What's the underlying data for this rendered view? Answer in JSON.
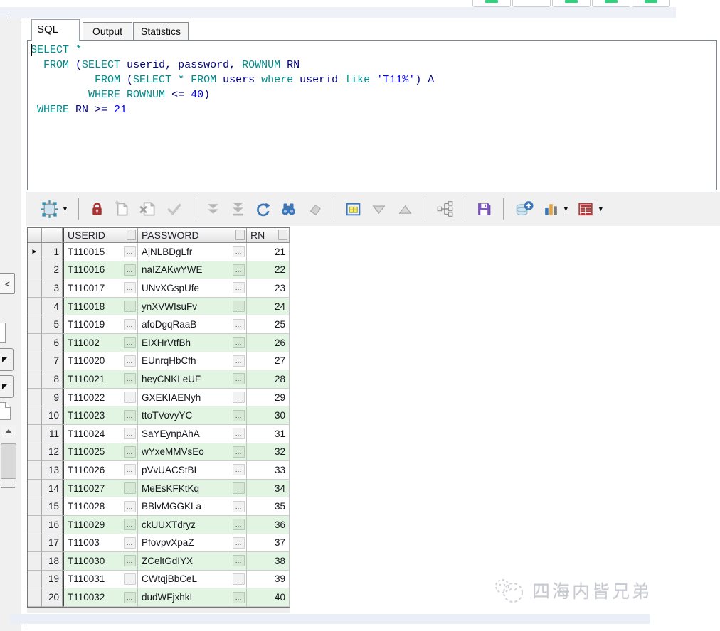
{
  "colors": {
    "keyword": "#008B8B",
    "identifier": "#000080",
    "literal": "#0000FF",
    "row_alt": "#e2f5e2",
    "lock_red": "#A83232",
    "save_purple": "#7E57C2",
    "toolbar_blue": "#3A76B8",
    "chart_orange": "#E3A53F",
    "report_red": "#B23A3A",
    "green_dash": "#35d07f"
  },
  "top_buttons": [
    {
      "glyph": true
    },
    {
      "glyph": false
    },
    {
      "glyph": true
    },
    {
      "glyph": true
    },
    {
      "glyph": true
    }
  ],
  "left_rail": {
    "collapse_label": "<"
  },
  "tabs": {
    "items": [
      {
        "label": "SQL",
        "active": true
      },
      {
        "label": "Output",
        "active": false
      },
      {
        "label": "Statistics",
        "active": false
      }
    ]
  },
  "editor": {
    "lines": [
      [
        {
          "t": "SELECT",
          "c": "kw"
        },
        {
          "t": " ",
          "c": "pl"
        },
        {
          "t": "*",
          "c": "kw"
        }
      ],
      [
        {
          "t": "  ",
          "c": "pl"
        },
        {
          "t": "FROM",
          "c": "kw"
        },
        {
          "t": " (",
          "c": "id"
        },
        {
          "t": "SELECT",
          "c": "kw"
        },
        {
          "t": " userid, password, ",
          "c": "id"
        },
        {
          "t": "ROWNUM",
          "c": "kw"
        },
        {
          "t": " RN",
          "c": "id"
        }
      ],
      [
        {
          "t": "          ",
          "c": "pl"
        },
        {
          "t": "FROM",
          "c": "kw"
        },
        {
          "t": " (",
          "c": "id"
        },
        {
          "t": "SELECT",
          "c": "kw"
        },
        {
          "t": " ",
          "c": "pl"
        },
        {
          "t": "*",
          "c": "kw"
        },
        {
          "t": " ",
          "c": "pl"
        },
        {
          "t": "FROM",
          "c": "kw"
        },
        {
          "t": " users ",
          "c": "id"
        },
        {
          "t": "where",
          "c": "kw"
        },
        {
          "t": " userid ",
          "c": "id"
        },
        {
          "t": "like",
          "c": "kw"
        },
        {
          "t": " ",
          "c": "pl"
        },
        {
          "t": "'T11%'",
          "c": "lit"
        },
        {
          "t": ") A",
          "c": "id"
        }
      ],
      [
        {
          "t": "         ",
          "c": "pl"
        },
        {
          "t": "WHERE",
          "c": "kw"
        },
        {
          "t": " ",
          "c": "pl"
        },
        {
          "t": "ROWNUM",
          "c": "kw"
        },
        {
          "t": " <= ",
          "c": "id"
        },
        {
          "t": "40",
          "c": "lit"
        },
        {
          "t": ")",
          "c": "id"
        }
      ],
      [
        {
          "t": " ",
          "c": "pl"
        },
        {
          "t": "WHERE",
          "c": "kw"
        },
        {
          "t": " RN >= ",
          "c": "id"
        },
        {
          "t": "21",
          "c": "lit"
        }
      ]
    ]
  },
  "toolbar": {
    "caret_glyph": "▼",
    "items": [
      {
        "name": "select-record",
        "caret": true
      },
      {
        "sep": true
      },
      {
        "name": "lock"
      },
      {
        "name": "insert-record",
        "disabled": true
      },
      {
        "name": "delete-record",
        "disabled": true
      },
      {
        "name": "post-edit",
        "disabled": true
      },
      {
        "sep": true
      },
      {
        "name": "fetch-next",
        "disabled": true
      },
      {
        "name": "fetch-all",
        "disabled": true
      },
      {
        "name": "refresh"
      },
      {
        "name": "find"
      },
      {
        "name": "erase",
        "disabled": true
      },
      {
        "sep": true
      },
      {
        "name": "form-view"
      },
      {
        "name": "nav-down",
        "disabled": true
      },
      {
        "name": "nav-up",
        "disabled": true
      },
      {
        "sep": true
      },
      {
        "name": "query-tree"
      },
      {
        "sep": true
      },
      {
        "name": "save"
      },
      {
        "sep": true
      },
      {
        "name": "export-data"
      },
      {
        "name": "chart",
        "caret": true
      },
      {
        "name": "report",
        "caret": true
      }
    ]
  },
  "grid": {
    "columns": [
      {
        "label": "USERID"
      },
      {
        "label": "PASSWORD"
      },
      {
        "label": "RN"
      }
    ],
    "active_row": 1,
    "active_indicator": "►",
    "ellipsis_label": "…",
    "rows": [
      {
        "n": "1",
        "userid": "T110015",
        "password": "AjNLBDgLfr",
        "rn": "21"
      },
      {
        "n": "2",
        "userid": "T110016",
        "password": "naIZAKwYWE",
        "rn": "22"
      },
      {
        "n": "3",
        "userid": "T110017",
        "password": "UNvXGspUfe",
        "rn": "23"
      },
      {
        "n": "4",
        "userid": "T110018",
        "password": "ynXVWIsuFv",
        "rn": "24"
      },
      {
        "n": "5",
        "userid": "T110019",
        "password": "afoDgqRaaB",
        "rn": "25"
      },
      {
        "n": "6",
        "userid": "T11002",
        "password": "EIXHrVtfBh",
        "rn": "26"
      },
      {
        "n": "7",
        "userid": "T110020",
        "password": "EUnrqHbCfh",
        "rn": "27"
      },
      {
        "n": "8",
        "userid": "T110021",
        "password": "heyCNKLeUF",
        "rn": "28"
      },
      {
        "n": "9",
        "userid": "T110022",
        "password": "GXEKIAENyh",
        "rn": "29"
      },
      {
        "n": "10",
        "userid": "T110023",
        "password": "ttoTVovyYC",
        "rn": "30"
      },
      {
        "n": "11",
        "userid": "T110024",
        "password": "SaYEynpAhA",
        "rn": "31"
      },
      {
        "n": "12",
        "userid": "T110025",
        "password": "wYxeMMVsEo",
        "rn": "32"
      },
      {
        "n": "13",
        "userid": "T110026",
        "password": "pVvUACStBI",
        "rn": "33"
      },
      {
        "n": "14",
        "userid": "T110027",
        "password": "MeEsKFKtKq",
        "rn": "34"
      },
      {
        "n": "15",
        "userid": "T110028",
        "password": "BBlvMGGKLa",
        "rn": "35"
      },
      {
        "n": "16",
        "userid": "T110029",
        "password": "ckUUXTdryz",
        "rn": "36"
      },
      {
        "n": "17",
        "userid": "T11003",
        "password": "PfovpvXpaZ",
        "rn": "37"
      },
      {
        "n": "18",
        "userid": "T110030",
        "password": "ZCeltGdIYX",
        "rn": "38"
      },
      {
        "n": "19",
        "userid": "T110031",
        "password": "CWtqjBbCeL",
        "rn": "39"
      },
      {
        "n": "20",
        "userid": "T110032",
        "password": "dudWFjxhkI",
        "rn": "40"
      }
    ]
  },
  "watermark": {
    "text": "四海内皆兄弟"
  }
}
